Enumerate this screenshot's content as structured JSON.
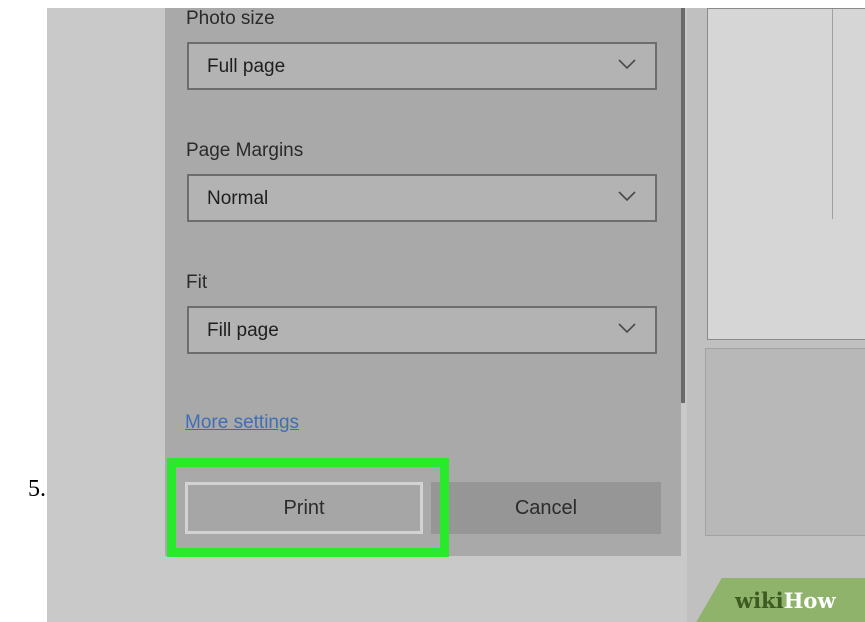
{
  "step_number": "5.",
  "dialog": {
    "photo_size": {
      "label": "Photo size",
      "value": "Full page"
    },
    "page_margins": {
      "label": "Page Margins",
      "value": "Normal"
    },
    "fit": {
      "label": "Fit",
      "value": "Fill page"
    },
    "more_settings": "More settings",
    "print_label": "Print",
    "cancel_label": "Cancel"
  },
  "watermark": {
    "part1": "wiki",
    "part2": "How"
  },
  "colors": {
    "highlight": "#28e92a",
    "link": "#3f6fb2",
    "panel": "#a9a9a9",
    "background": "#c9c9c9"
  },
  "icons": [
    "chevron-down-icon"
  ]
}
